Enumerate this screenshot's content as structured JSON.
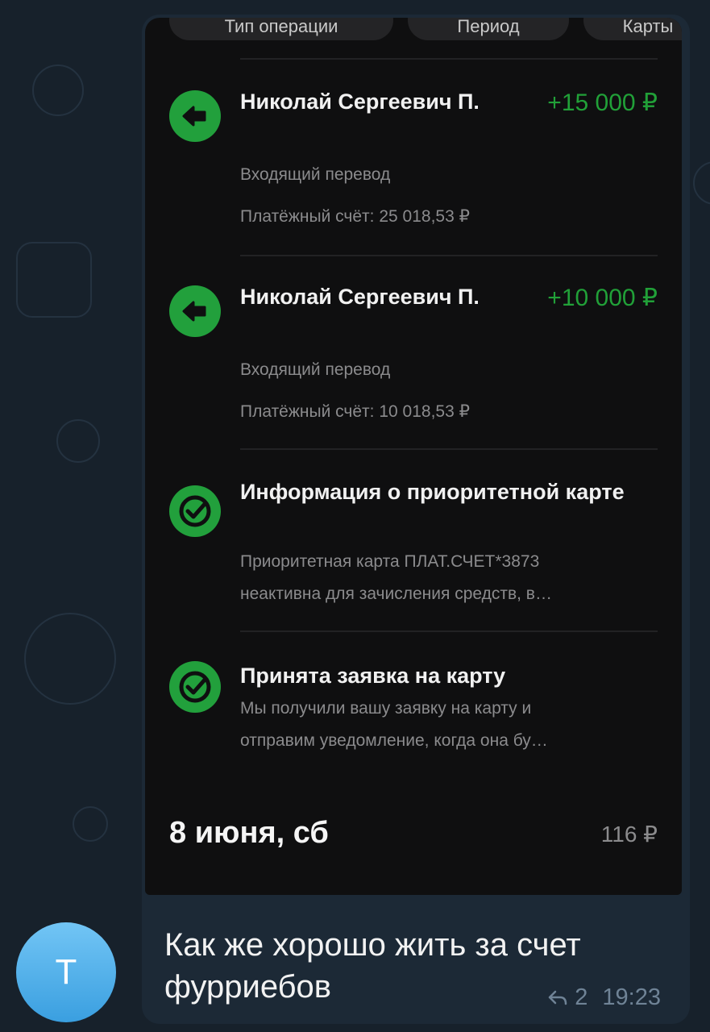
{
  "screenshot": {
    "filters": [
      "Тип операции",
      "Период",
      "Карты"
    ],
    "operations": [
      {
        "icon": "arrow-left-icon",
        "title": "Николай Сергеевич П.",
        "amount": "+15 000 ₽",
        "subtitle": "Входящий перевод",
        "detail": "Платёжный счёт: 25 018,53 ₽"
      },
      {
        "icon": "arrow-left-icon",
        "title": "Николай Сергеевич П.",
        "amount": "+10 000 ₽",
        "subtitle": "Входящий перевод",
        "detail": "Платёжный счёт: 10 018,53 ₽"
      },
      {
        "icon": "sber-check-icon",
        "title": "Информация о приоритетной карте",
        "line1": "Приоритетная карта ПЛАТ.СЧЕТ*3873",
        "line2": "неактивна для зачисления средств, в…"
      },
      {
        "icon": "sber-check-icon",
        "title": "Принята заявка на карту",
        "line1": "Мы получили вашу заявку на карту и",
        "line2": "отправим уведомление, когда она бу…"
      }
    ],
    "date_header": "8 июня, сб",
    "day_total": "116 ₽"
  },
  "message": {
    "text": "Как же хорошо жить за счет фурриебов",
    "replies": "2",
    "time": "19:23"
  },
  "avatar": {
    "letter": "Т"
  },
  "colors": {
    "accent_green": "#21a038",
    "bubble": "#1c2936",
    "background": "#17212b"
  }
}
